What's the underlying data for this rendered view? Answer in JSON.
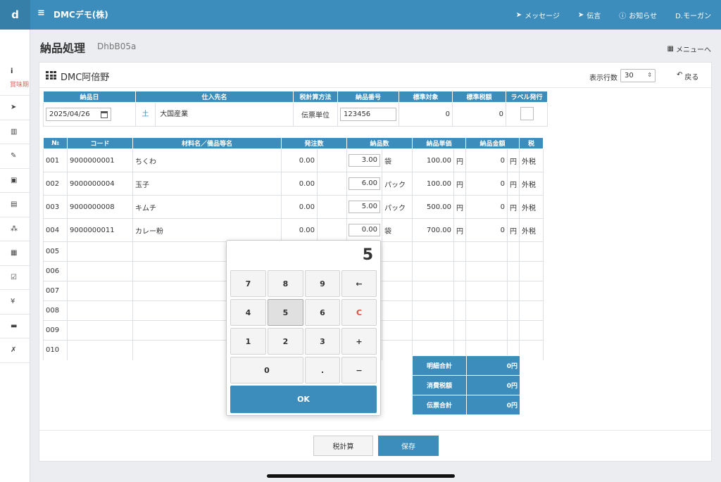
{
  "topbar": {
    "brand": "d",
    "app_title": "DMCデモ(株)",
    "nav": [
      "メッセージ",
      "伝言",
      "お知らせ",
      "D.モーガン"
    ]
  },
  "sidebar": {
    "info_label": "賞味期"
  },
  "page": {
    "title": "納品処理",
    "code": "DhbB05a",
    "menu_link": "メニューへ"
  },
  "card": {
    "store_name": "DMC阿倍野",
    "rows_label": "表示行数",
    "rows_value": "30",
    "back_label": "戻る"
  },
  "header_table": {
    "columns": [
      "納品日",
      "仕入先名",
      "税計算方法",
      "納品番号",
      "標準対象",
      "標準税額",
      "ラベル発行"
    ],
    "date": "2025/04/26",
    "weekday": "土",
    "supplier": "大国産業",
    "tax_method": "伝票単位",
    "slip_no": "123456",
    "std_target": "0",
    "std_tax": "0"
  },
  "items_table": {
    "columns": [
      "№",
      "コード",
      "材料名／備品等名",
      "発注数",
      "納品数",
      "納品単価",
      "納品金額",
      "税"
    ],
    "rows": [
      {
        "no": "001",
        "code": "9000000001",
        "name": "ちくわ",
        "order": "0.00",
        "qty": "3.00",
        "unit": "袋",
        "price": "100.00",
        "yen1": "円",
        "amount": "0",
        "yen2": "円",
        "tax": "外税"
      },
      {
        "no": "002",
        "code": "9000000004",
        "name": "玉子",
        "order": "0.00",
        "qty": "6.00",
        "unit": "パック",
        "price": "100.00",
        "yen1": "円",
        "amount": "0",
        "yen2": "円",
        "tax": "外税"
      },
      {
        "no": "003",
        "code": "9000000008",
        "name": "キムチ",
        "order": "0.00",
        "qty": "5.00",
        "unit": "パック",
        "price": "500.00",
        "yen1": "円",
        "amount": "0",
        "yen2": "円",
        "tax": "外税"
      },
      {
        "no": "004",
        "code": "9000000011",
        "name": "カレー粉",
        "order": "0.00",
        "qty": "0.00",
        "unit": "袋",
        "price": "700.00",
        "yen1": "円",
        "amount": "0",
        "yen2": "円",
        "tax": "外税"
      }
    ],
    "empty_rows": [
      "005",
      "006",
      "007",
      "008",
      "009",
      "010"
    ]
  },
  "totals": [
    {
      "label": "明細合計",
      "value": "0円"
    },
    {
      "label": "消費税額",
      "value": "0円"
    },
    {
      "label": "伝票合計",
      "value": "0円"
    }
  ],
  "buttons": {
    "tax_calc": "税計算",
    "save": "保存"
  },
  "keypad": {
    "display": "5",
    "keys": [
      "7",
      "8",
      "9",
      "←",
      "4",
      "5",
      "6",
      "C",
      "1",
      "2",
      "3",
      "+",
      "0",
      ".",
      "−"
    ],
    "pressed_key": "5",
    "ok": "OK"
  }
}
